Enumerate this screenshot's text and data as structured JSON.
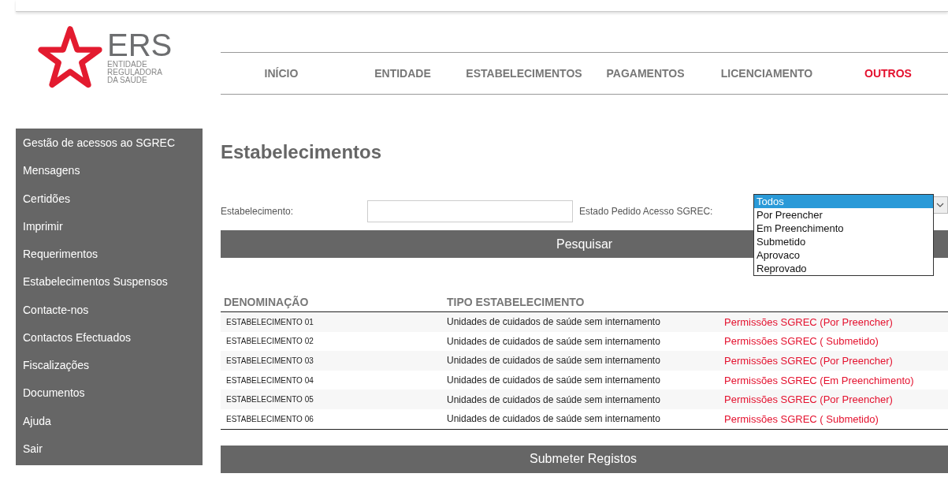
{
  "logo": {
    "name": "ERS",
    "subtitle": [
      "ENTIDADE",
      "REGULADORA",
      "DA SAÚDE"
    ]
  },
  "nav": [
    {
      "label": "INÍCIO",
      "selected": false
    },
    {
      "label": "ENTIDADE",
      "selected": false
    },
    {
      "label": "ESTABELECIMENTOS",
      "selected": false
    },
    {
      "label": "PAGAMENTOS",
      "selected": false
    },
    {
      "label": "LICENCIAMENTO",
      "selected": false
    },
    {
      "label": "OUTROS",
      "selected": true
    }
  ],
  "sidebar": {
    "items": [
      "Gestão de acessos ao SGREC",
      "Mensagens",
      "Certidões",
      "Imprimir",
      "Requerimentos",
      "Estabelecimentos Suspensos",
      "Contacte-nos",
      "Contactos Efectuados",
      "Fiscalizações",
      "Documentos",
      "Ajuda",
      "Sair"
    ]
  },
  "page_title": "Estabelecimentos",
  "filters": {
    "establishment_label": "Estabelecimento:",
    "status_label": "Estado Pedido Acesso SGREC:",
    "status_options": [
      {
        "label": "Todos",
        "selected": true
      },
      {
        "label": "Por Preencher",
        "selected": false
      },
      {
        "label": "Em Preenchimento",
        "selected": false
      },
      {
        "label": "Submetido",
        "selected": false
      },
      {
        "label": "Aprovaco",
        "selected": false
      },
      {
        "label": "Reprovado",
        "selected": false
      }
    ]
  },
  "search_button": "Pesquisar",
  "table": {
    "columns": [
      "DENOMINAÇÃO",
      "TIPO ESTABELECIMENTO"
    ],
    "rows": [
      {
        "name": "ESTABELECIMENTO 01",
        "type": "Unidades de cuidados de saúde sem internamento",
        "link": "Permissões SGREC (Por Preencher)"
      },
      {
        "name": "ESTABELECIMENTO 02",
        "type": "Unidades de cuidados de saúde sem internamento",
        "link": "Permissões SGREC ( Submetido)"
      },
      {
        "name": "ESTABELECIMENTO 03",
        "type": "Unidades de cuidados de saúde sem internamento",
        "link": "Permissões SGREC (Por Preencher)"
      },
      {
        "name": "ESTABELECIMENTO 04",
        "type": "Unidades de cuidados de saúde sem internamento",
        "link": "Permissões SGREC (Em Preenchimento)"
      },
      {
        "name": "ESTABELECIMENTO 05",
        "type": "Unidades de cuidados de saúde sem internamento",
        "link": "Permissões SGREC (Por Preencher)"
      },
      {
        "name": "ESTABELECIMENTO 06",
        "type": "Unidades de cuidados de saúde sem internamento",
        "link": "Permissões SGREC ( Submetido)"
      }
    ]
  },
  "submit_button": "Submeter Registos"
}
